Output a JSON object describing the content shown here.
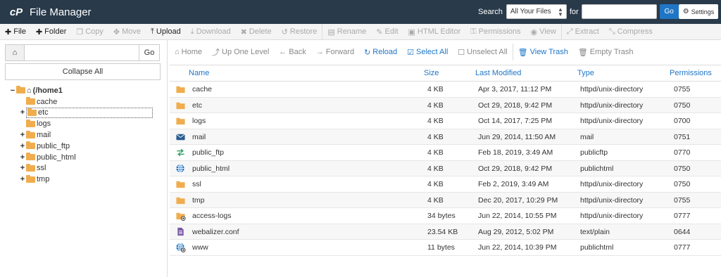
{
  "header": {
    "logo_icon": "cpanel-logo-icon",
    "title": "File Manager",
    "search_label": "Search",
    "search_scope": "All Your Files",
    "for_label": "for",
    "search_value": "",
    "go_label": "Go",
    "settings_label": "Settings"
  },
  "toolbar": [
    {
      "label": "File",
      "icon": "plus-icon",
      "enabled": true
    },
    {
      "label": "Folder",
      "icon": "plus-icon",
      "enabled": true
    },
    {
      "label": "Copy",
      "icon": "copy-icon",
      "enabled": false
    },
    {
      "label": "Move",
      "icon": "move-icon",
      "enabled": false
    },
    {
      "label": "Upload",
      "icon": "upload-icon",
      "enabled": true
    },
    {
      "label": "Download",
      "icon": "download-icon",
      "enabled": false
    },
    {
      "label": "Delete",
      "icon": "delete-icon",
      "enabled": false
    },
    {
      "label": "Restore",
      "icon": "restore-icon",
      "enabled": false
    },
    {
      "label": "Rename",
      "icon": "rename-icon",
      "enabled": false
    },
    {
      "label": "Edit",
      "icon": "pencil-icon",
      "enabled": false
    },
    {
      "label": "HTML Editor",
      "icon": "html-editor-icon",
      "enabled": false
    },
    {
      "label": "Permissions",
      "icon": "key-icon",
      "enabled": false
    },
    {
      "label": "View",
      "icon": "eye-icon",
      "enabled": false
    },
    {
      "label": "Extract",
      "icon": "extract-icon",
      "enabled": false
    },
    {
      "label": "Compress",
      "icon": "compress-icon",
      "enabled": false
    }
  ],
  "left_panel": {
    "path_value": "",
    "go_label": "Go",
    "collapse_label": "Collapse All",
    "root_label": "(/home1",
    "tree": [
      {
        "label": "cache",
        "toggle": "",
        "selected": false
      },
      {
        "label": "etc",
        "toggle": "+",
        "selected": true
      },
      {
        "label": "logs",
        "toggle": "",
        "selected": false
      },
      {
        "label": "mail",
        "toggle": "+",
        "selected": false
      },
      {
        "label": "public_ftp",
        "toggle": "+",
        "selected": false
      },
      {
        "label": "public_html",
        "toggle": "+",
        "selected": false
      },
      {
        "label": "ssl",
        "toggle": "+",
        "selected": false
      },
      {
        "label": "tmp",
        "toggle": "+",
        "selected": false
      }
    ]
  },
  "right_toolbar": [
    {
      "label": "Home",
      "icon": "home-icon",
      "blue": false
    },
    {
      "label": "Up One Level",
      "icon": "up-level-icon",
      "blue": false
    },
    {
      "label": "Back",
      "icon": "arrow-left-icon",
      "blue": false
    },
    {
      "label": "Forward",
      "icon": "arrow-right-icon",
      "blue": false
    },
    {
      "label": "Reload",
      "icon": "reload-icon",
      "blue": true
    },
    {
      "label": "Select All",
      "icon": "checkbox-checked-icon",
      "blue": true
    },
    {
      "label": "Unselect All",
      "icon": "checkbox-empty-icon",
      "blue": false
    },
    {
      "label": "View Trash",
      "icon": "trash-icon",
      "blue": true
    },
    {
      "label": "Empty Trash",
      "icon": "trash-icon",
      "blue": false
    }
  ],
  "table": {
    "columns": [
      "Name",
      "Size",
      "Last Modified",
      "Type",
      "Permissions"
    ],
    "rows": [
      {
        "icon": "folder-icon",
        "name": "cache",
        "size": "4 KB",
        "modified": "Apr 3, 2017, 11:12 PM",
        "type": "httpd/unix-directory",
        "perms": "0755"
      },
      {
        "icon": "folder-icon",
        "name": "etc",
        "size": "4 KB",
        "modified": "Oct 29, 2018, 9:42 PM",
        "type": "httpd/unix-directory",
        "perms": "0750"
      },
      {
        "icon": "folder-icon",
        "name": "logs",
        "size": "4 KB",
        "modified": "Oct 14, 2017, 7:25 PM",
        "type": "httpd/unix-directory",
        "perms": "0700"
      },
      {
        "icon": "mail-icon",
        "name": "mail",
        "size": "4 KB",
        "modified": "Jun 29, 2014, 11:50 AM",
        "type": "mail",
        "perms": "0751"
      },
      {
        "icon": "transfer-icon",
        "name": "public_ftp",
        "size": "4 KB",
        "modified": "Feb 18, 2019, 3:49 AM",
        "type": "publicftp",
        "perms": "0770"
      },
      {
        "icon": "globe-icon",
        "name": "public_html",
        "size": "4 KB",
        "modified": "Oct 29, 2018, 9:42 PM",
        "type": "publichtml",
        "perms": "0750"
      },
      {
        "icon": "folder-icon",
        "name": "ssl",
        "size": "4 KB",
        "modified": "Feb 2, 2019, 3:49 AM",
        "type": "httpd/unix-directory",
        "perms": "0750"
      },
      {
        "icon": "folder-icon",
        "name": "tmp",
        "size": "4 KB",
        "modified": "Dec 20, 2017, 10:29 PM",
        "type": "httpd/unix-directory",
        "perms": "0755"
      },
      {
        "icon": "folder-link-icon",
        "name": "access-logs",
        "size": "34 bytes",
        "modified": "Jun 22, 2014, 10:55 PM",
        "type": "httpd/unix-directory",
        "perms": "0777"
      },
      {
        "icon": "text-file-icon",
        "name": "webalizer.conf",
        "size": "23.54 KB",
        "modified": "Aug 29, 2012, 5:02 PM",
        "type": "text/plain",
        "perms": "0644"
      },
      {
        "icon": "globe-link-icon",
        "name": "www",
        "size": "11 bytes",
        "modified": "Jun 22, 2014, 10:39 PM",
        "type": "publichtml",
        "perms": "0777"
      }
    ]
  },
  "colors": {
    "header_bg": "#293a4a",
    "accent_blue": "#1f76c5",
    "folder": "#f0ad4e"
  }
}
